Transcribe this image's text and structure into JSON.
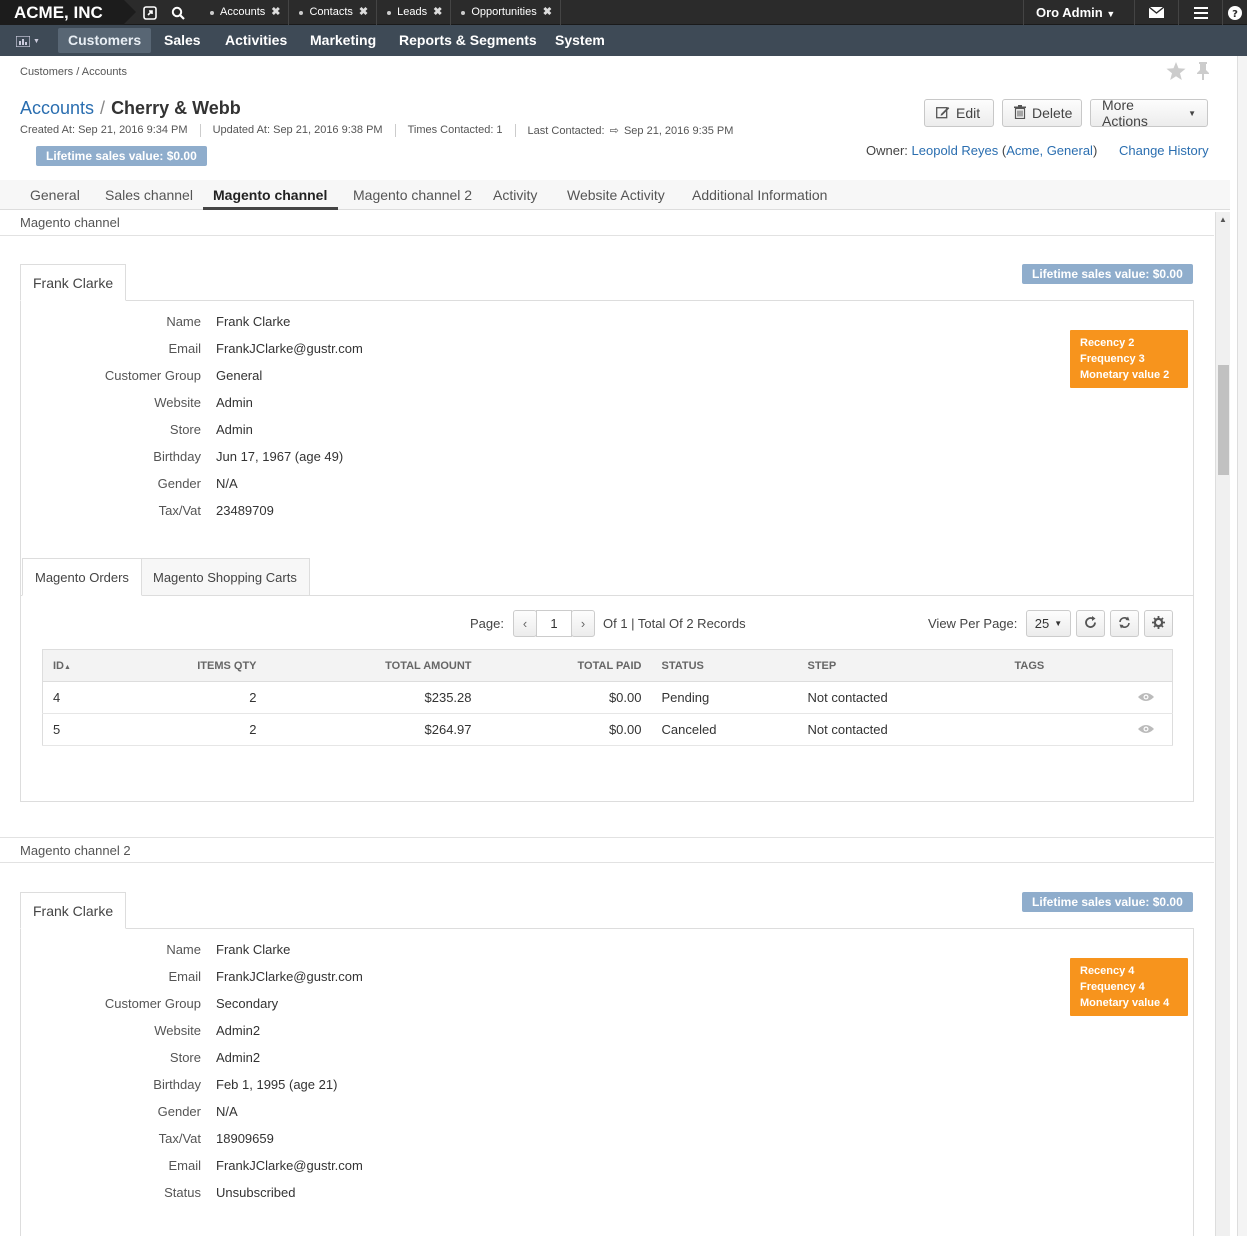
{
  "top": {
    "brand": "ACME, INC",
    "pinned_tabs": [
      "Accounts",
      "Contacts",
      "Leads",
      "Opportunities"
    ],
    "user": "Oro Admin"
  },
  "nav": {
    "items": [
      "Customers",
      "Sales",
      "Activities",
      "Marketing",
      "Reports & Segments",
      "System"
    ],
    "active": "Customers"
  },
  "breadcrumb": "Customers / Accounts",
  "header": {
    "bc_link": "Accounts",
    "separator": "/",
    "title": "Cherry & Webb",
    "created": "Created At: Sep 21, 2016 9:34 PM",
    "updated": "Updated At: Sep 21, 2016 9:38 PM",
    "times_contacted": "Times Contacted: 1",
    "last_contacted_label": "Last Contacted:",
    "last_contacted_value": "Sep 21, 2016 9:35 PM",
    "lifetime": "Lifetime sales value: $0.00",
    "owner_label": "Owner:",
    "owner_name": "Leopold Reyes",
    "owner_org_open": "(",
    "owner_org": "Acme, General",
    "owner_org_close": ")",
    "change_history": "Change History"
  },
  "actions": {
    "edit": "Edit",
    "delete": "Delete",
    "more": "More Actions"
  },
  "tabs": [
    "General",
    "Sales channel",
    "Magento channel",
    "Magento channel 2",
    "Activity",
    "Website Activity",
    "Additional Information"
  ],
  "section1": {
    "title": "Magento channel",
    "card_tab": "Frank Clarke",
    "lifetime": "Lifetime sales value: $0.00",
    "rfm": [
      "Recency 2",
      "Frequency 3",
      "Monetary value 2"
    ],
    "fields": [
      {
        "k": "Name",
        "v": "Frank Clarke",
        "link": true
      },
      {
        "k": "Email",
        "v": "FrankJClarke@gustr.com",
        "link": true
      },
      {
        "k": "Customer Group",
        "v": "General"
      },
      {
        "k": "Website",
        "v": "Admin"
      },
      {
        "k": "Store",
        "v": "Admin"
      },
      {
        "k": "Birthday",
        "v": "Jun 17, 1967 (age 49)"
      },
      {
        "k": "Gender",
        "v": "N/A"
      },
      {
        "k": "Tax/Vat",
        "v": "23489709"
      }
    ],
    "inner_tabs": [
      "Magento Orders",
      "Magento Shopping Carts"
    ],
    "pager": {
      "page_label": "Page:",
      "page_value": "1",
      "of_text": "Of 1 | Total Of 2 Records",
      "view_per_page_label": "View Per Page:",
      "per_page": "25"
    },
    "grid": {
      "columns": [
        "ID",
        "ITEMS QTY",
        "TOTAL AMOUNT",
        "TOTAL PAID",
        "STATUS",
        "STEP",
        "TAGS"
      ],
      "rows": [
        [
          "4",
          "2",
          "$235.28",
          "$0.00",
          "Pending",
          "Not contacted"
        ],
        [
          "5",
          "2",
          "$264.97",
          "$0.00",
          "Canceled",
          "Not contacted"
        ]
      ]
    }
  },
  "section2": {
    "title": "Magento channel 2",
    "card_tab": "Frank Clarke",
    "lifetime": "Lifetime sales value: $0.00",
    "rfm": [
      "Recency 4",
      "Frequency 4",
      "Monetary value 4"
    ],
    "fields": [
      {
        "k": "Name",
        "v": "Frank Clarke",
        "link": true
      },
      {
        "k": "Email",
        "v": "FrankJClarke@gustr.com",
        "link": true
      },
      {
        "k": "Customer Group",
        "v": "Secondary"
      },
      {
        "k": "Website",
        "v": "Admin2"
      },
      {
        "k": "Store",
        "v": "Admin2"
      },
      {
        "k": "Birthday",
        "v": "Feb 1, 1995 (age 21)"
      },
      {
        "k": "Gender",
        "v": "N/A"
      },
      {
        "k": "Tax/Vat",
        "v": "18909659"
      },
      {
        "k": "Email",
        "v": "FrankJClarke@gustr.com"
      },
      {
        "k": "Status",
        "v": "Unsubscribed"
      }
    ]
  },
  "icons": {
    "favorite": "star-icon",
    "pin": "pin-icon",
    "edit": "pencil-icon",
    "delete": "trash-icon",
    "view": "eye-icon"
  },
  "colors": {
    "nav_bg": "#3e4a56",
    "rfm": "#f7941d",
    "lifetime_badge": "#8fadcc",
    "link": "#2a6eb0"
  }
}
